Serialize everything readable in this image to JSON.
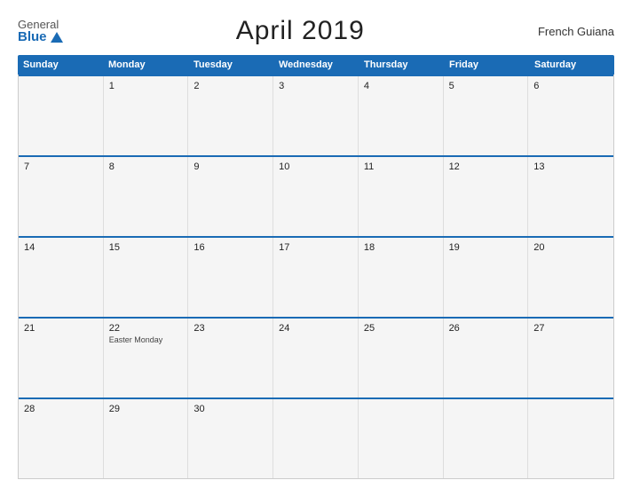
{
  "logo": {
    "general": "General",
    "blue": "Blue",
    "triangle": ""
  },
  "title": "April 2019",
  "region": "French Guiana",
  "calendar": {
    "headers": [
      "Sunday",
      "Monday",
      "Tuesday",
      "Wednesday",
      "Thursday",
      "Friday",
      "Saturday"
    ],
    "weeks": [
      [
        {
          "day": "",
          "holiday": ""
        },
        {
          "day": "1",
          "holiday": ""
        },
        {
          "day": "2",
          "holiday": ""
        },
        {
          "day": "3",
          "holiday": ""
        },
        {
          "day": "4",
          "holiday": ""
        },
        {
          "day": "5",
          "holiday": ""
        },
        {
          "day": "6",
          "holiday": ""
        }
      ],
      [
        {
          "day": "7",
          "holiday": ""
        },
        {
          "day": "8",
          "holiday": ""
        },
        {
          "day": "9",
          "holiday": ""
        },
        {
          "day": "10",
          "holiday": ""
        },
        {
          "day": "11",
          "holiday": ""
        },
        {
          "day": "12",
          "holiday": ""
        },
        {
          "day": "13",
          "holiday": ""
        }
      ],
      [
        {
          "day": "14",
          "holiday": ""
        },
        {
          "day": "15",
          "holiday": ""
        },
        {
          "day": "16",
          "holiday": ""
        },
        {
          "day": "17",
          "holiday": ""
        },
        {
          "day": "18",
          "holiday": ""
        },
        {
          "day": "19",
          "holiday": ""
        },
        {
          "day": "20",
          "holiday": ""
        }
      ],
      [
        {
          "day": "21",
          "holiday": ""
        },
        {
          "day": "22",
          "holiday": "Easter Monday"
        },
        {
          "day": "23",
          "holiday": ""
        },
        {
          "day": "24",
          "holiday": ""
        },
        {
          "day": "25",
          "holiday": ""
        },
        {
          "day": "26",
          "holiday": ""
        },
        {
          "day": "27",
          "holiday": ""
        }
      ],
      [
        {
          "day": "28",
          "holiday": ""
        },
        {
          "day": "29",
          "holiday": ""
        },
        {
          "day": "30",
          "holiday": ""
        },
        {
          "day": "",
          "holiday": ""
        },
        {
          "day": "",
          "holiday": ""
        },
        {
          "day": "",
          "holiday": ""
        },
        {
          "day": "",
          "holiday": ""
        }
      ]
    ]
  }
}
